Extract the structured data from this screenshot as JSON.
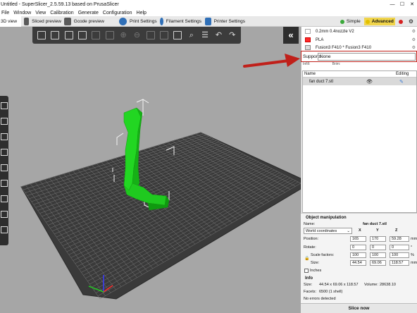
{
  "window": {
    "title": "Untitled - SuperSlicer_2.5.59.13  based on PrusaSlicer",
    "minimize": "—",
    "maximize": "☐",
    "close": "✕"
  },
  "menu": [
    "File",
    "Window",
    "View",
    "Calibration",
    "Generate",
    "Configuration",
    "Help"
  ],
  "tabs": {
    "view_3d": "3D view",
    "sliced_preview": "Sliced preview",
    "gcode_preview": "Gcode preview",
    "print_settings": "Print Settings",
    "filament_settings": "Filament Settings",
    "printer_settings": "Printer Settings"
  },
  "modes": {
    "simple": "Simple",
    "advanced": "Advanced",
    "simple_color": "#3aa83a",
    "advanced_color": "#e3c000",
    "expert_color": "#d62020"
  },
  "presets": {
    "print": "0.2mm 0.4nozzle V2",
    "filament": "PLA",
    "printer": "Fusion3 F410 * Fusion3 F410",
    "filament_color": "#ff2a2a"
  },
  "supports": {
    "label": "Supports",
    "value": "None",
    "infill_label": "Infill:",
    "brim_label": "Brim:"
  },
  "object_list": {
    "col_name": "Name",
    "col_editing": "Editing",
    "objects": [
      {
        "name": "fan duct 7.stl"
      }
    ]
  },
  "object_manipulation": {
    "title": "Object manipulation",
    "name_label": "Name:",
    "name_value": "fan duct 7.stl",
    "coords": "World coordinates",
    "axes": [
      "X",
      "Y",
      "Z"
    ],
    "position_label": "Position:",
    "position": [
      "165",
      "170",
      "59.28"
    ],
    "position_unit": "mm",
    "rotate_label": "Rotate:",
    "rotate": [
      "0",
      "0",
      "0"
    ],
    "rotate_unit": "°",
    "scale_label": "Scale factors:",
    "scale": [
      "100",
      "100",
      "100"
    ],
    "scale_unit": "%",
    "size_label": "Size:",
    "size": [
      "44.54",
      "69.06",
      "118.57"
    ],
    "size_unit": "mm",
    "inches_label": "Inches"
  },
  "info": {
    "title": "Info",
    "size_label": "Size:",
    "size_value": "44.54 x 69.06 x 118.57",
    "volume_label": "Volume:",
    "volume_value": "28638.10",
    "facets_label": "Facets:",
    "facets_value": "6500 (1 shell)",
    "errors": "No errors detected"
  },
  "slice_button": "Slice now",
  "colors": {
    "viewport_bg": "#a6a6a6",
    "bed": "#3a3a3a",
    "model": "#22d622",
    "highlight": "#c0201a"
  }
}
